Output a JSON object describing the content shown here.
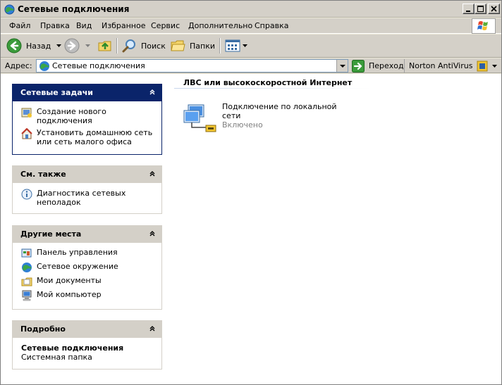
{
  "window": {
    "title": "Сетевые подключения",
    "minimize_glyph": "0",
    "maximize_glyph": "1",
    "close_glyph": "r"
  },
  "menu": {
    "items": [
      "Файл",
      "Правка",
      "Вид",
      "Избранное",
      "Сервис",
      "Дополнительно",
      "Справка"
    ]
  },
  "toolbar": {
    "back": "Назад",
    "search": "Поиск",
    "folders": "Папки"
  },
  "address": {
    "label": "Адрес:",
    "value": "Сетевые подключения",
    "go": "Переход",
    "norton": "Norton AntiVirus"
  },
  "panes": {
    "network_tasks": {
      "title": "Сетевые задачи",
      "items": [
        {
          "label": "Создание нового подключения",
          "icon": "new-connection-icon"
        },
        {
          "label": "Установить домашнюю сеть или сеть малого офиса",
          "icon": "home-network-icon"
        }
      ]
    },
    "see_also": {
      "title": "См. также",
      "items": [
        {
          "label": "Диагностика сетевых неполадок",
          "icon": "info-icon"
        }
      ]
    },
    "other_places": {
      "title": "Другие места",
      "items": [
        {
          "label": "Панель управления",
          "icon": "control-panel-icon"
        },
        {
          "label": "Сетевое окружение",
          "icon": "network-places-icon"
        },
        {
          "label": "Мои документы",
          "icon": "my-documents-icon"
        },
        {
          "label": "Мой компьютер",
          "icon": "my-computer-icon"
        }
      ]
    },
    "details": {
      "title": "Подробно",
      "name": "Сетевые подключения",
      "type": "Системная папка"
    }
  },
  "main": {
    "group_title": "ЛВС или высокоскоростной Интернет",
    "connection": {
      "name": "Подключение по локальной сети",
      "status": "Включено"
    }
  },
  "colors": {
    "pane_blue": "#0a246a",
    "pane_grey": "#d4d0c8",
    "status_grey": "#808080"
  }
}
